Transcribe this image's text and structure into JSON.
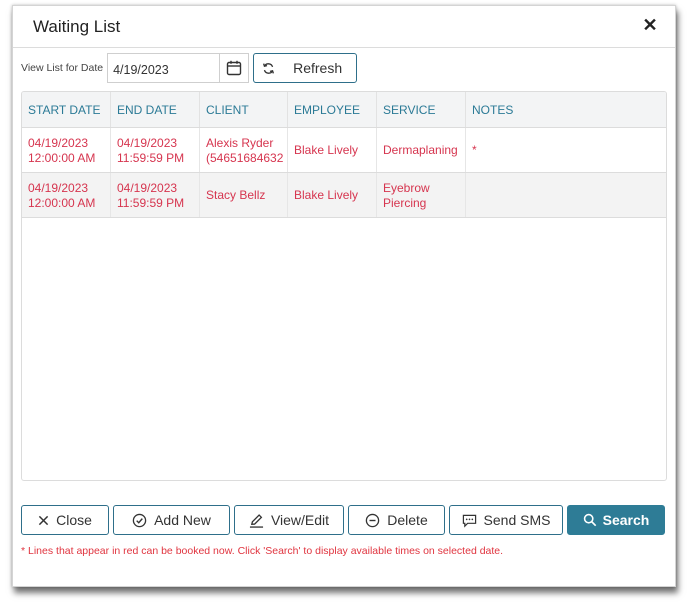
{
  "dialog": {
    "title": "Waiting List"
  },
  "filter": {
    "label": "View List for Date",
    "date_value": "4/19/2023",
    "refresh_label": "Refresh"
  },
  "grid": {
    "columns": [
      "START DATE",
      "END DATE",
      "CLIENT",
      "EMPLOYEE",
      "SERVICE",
      "NOTES"
    ],
    "rows": [
      [
        "04/19/2023\n12:00:00 AM",
        "04/19/2023\n11:59:59 PM",
        "Alexis Ryder\n(54651684632",
        "Blake Lively",
        "Dermaplaning",
        "*"
      ],
      [
        "04/19/2023\n12:00:00 AM",
        "04/19/2023\n11:59:59 PM",
        "Stacy Bellz",
        "Blake Lively",
        "Eyebrow\nPiercing",
        ""
      ]
    ]
  },
  "actions": {
    "close": "Close",
    "add_new": "Add New",
    "view_edit": "View/Edit",
    "delete": "Delete",
    "send_sms": "Send SMS",
    "search": "Search"
  },
  "footer_note": "* Lines that appear in red can be booked now. Click 'Search' to display available times on selected date.",
  "colors": {
    "accent": "#2e7c96",
    "header_text": "#2b7a96",
    "bookable_row_text": "#d6354f",
    "note_text": "#e0343f"
  },
  "icons": {
    "dialog_close": "close-icon",
    "calendar": "calendar-icon",
    "refresh": "refresh-icon",
    "close": "x-icon",
    "add_new": "check-circle-icon",
    "view_edit": "pencil-icon",
    "delete": "minus-circle-icon",
    "send_sms": "message-icon",
    "search": "search-icon"
  }
}
